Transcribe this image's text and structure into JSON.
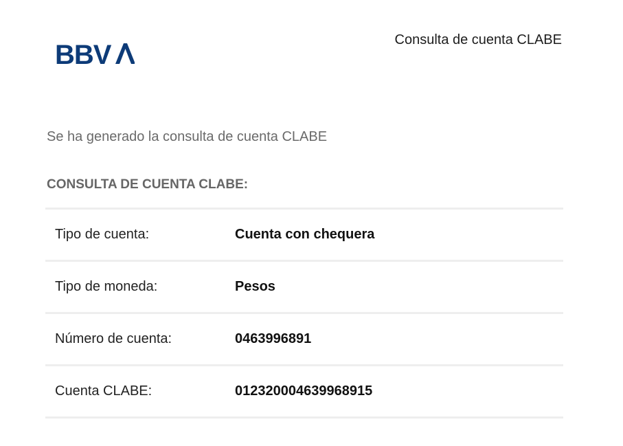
{
  "brand": {
    "logo_text": "BBVA",
    "logo_color": "#0d3b78"
  },
  "header": {
    "title": "Consulta de cuenta CLABE"
  },
  "intro": "Se ha generado la consulta de cuenta CLABE",
  "section_title": "CONSULTA DE CUENTA CLABE:",
  "details": [
    {
      "label": "Tipo de cuenta:",
      "value": "Cuenta con chequera"
    },
    {
      "label": "Tipo de moneda:",
      "value": "Pesos"
    },
    {
      "label": "Número de cuenta:",
      "value": "0463996891"
    },
    {
      "label": "Cuenta CLABE:",
      "value": "012320004639968915"
    }
  ]
}
